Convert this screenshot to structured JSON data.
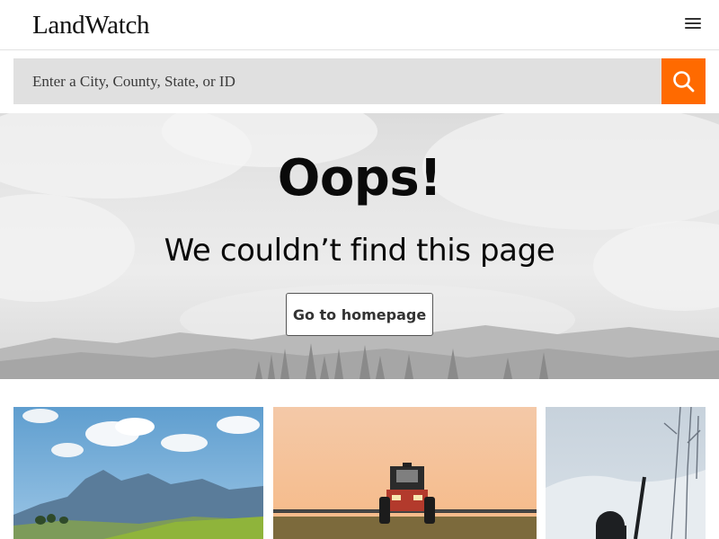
{
  "header": {
    "logo_text": "LandWatch",
    "menu_icon": "hamburger-menu-icon"
  },
  "search": {
    "placeholder": "Enter a City, County, State, or ID",
    "button_icon": "search-icon",
    "button_color": "#ff6a00"
  },
  "hero": {
    "title": "Oops!",
    "subtitle": "We couldn’t find this page",
    "button_label": "Go to homepage"
  },
  "cards": [
    {
      "image": "mountain-landscape-image"
    },
    {
      "image": "tractor-field-image"
    },
    {
      "image": "hunter-winter-image"
    }
  ]
}
